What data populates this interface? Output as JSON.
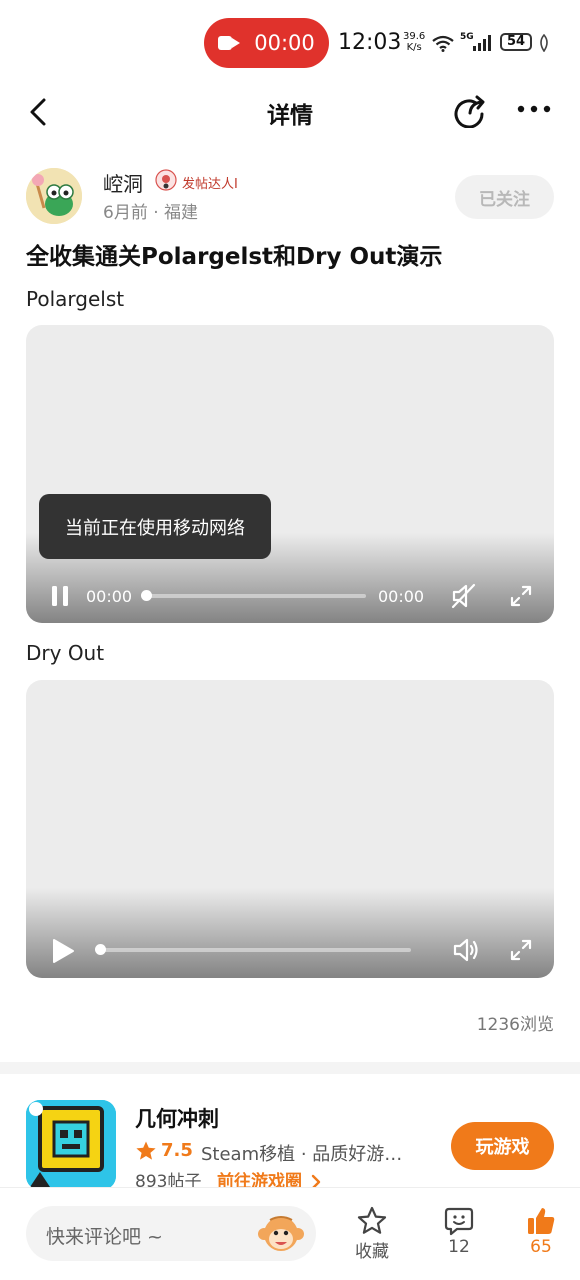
{
  "status_bar": {
    "record_time": "00:00",
    "time": "12:03",
    "net_speed_value": "39.6",
    "net_speed_unit": "K/s",
    "network": "5G",
    "battery": "54"
  },
  "header": {
    "title": "详情"
  },
  "author": {
    "name": "崆洞",
    "badge": "发帖达人I",
    "meta": "6月前 · 福建",
    "follow_label": "已关注"
  },
  "post": {
    "title": "全收集通关Polargelst和Dry Out演示",
    "sections": [
      {
        "label": "Polargelst",
        "current_time": "00:00",
        "duration": "00:00",
        "state": "playing",
        "muted": true,
        "progress": 0
      },
      {
        "label": "Dry Out",
        "state": "paused",
        "muted": false,
        "progress": 0
      }
    ],
    "toast": "当前正在使用移动网络",
    "views": "1236浏览"
  },
  "game": {
    "name": "几何冲刺",
    "rating": "7.5",
    "description": "Steam移植 · 品质好游…",
    "posts": "893帖子",
    "link_label": "前往游戏圈",
    "play_label": "玩游戏"
  },
  "bottom_bar": {
    "comment_placeholder": "快来评论吧 ~",
    "favorite_label": "收藏",
    "comment_count": "12",
    "like_count": "65"
  },
  "colors": {
    "accent": "#f07a1a",
    "record": "#e0322c"
  }
}
